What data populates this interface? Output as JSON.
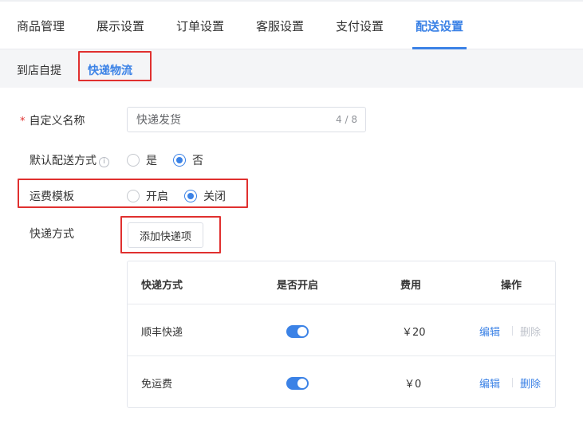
{
  "top_tabs": [
    {
      "label": "商品管理"
    },
    {
      "label": "展示设置"
    },
    {
      "label": "订单设置"
    },
    {
      "label": "客服设置"
    },
    {
      "label": "支付设置"
    },
    {
      "label": "配送设置"
    }
  ],
  "top_tabs_active_index": 5,
  "sub_tabs": [
    {
      "label": "到店自提"
    },
    {
      "label": "快递物流"
    }
  ],
  "sub_tabs_active_index": 1,
  "form": {
    "custom_name": {
      "required_mark": "*",
      "label": "自定义名称",
      "value": "快递发货",
      "counter": "4 / 8"
    },
    "default_delivery": {
      "label": "默认配送方式",
      "info_glyph": "i",
      "options": [
        "是",
        "否"
      ],
      "selected_index": 1
    },
    "freight_template": {
      "label": "运费模板",
      "options": [
        "开启",
        "关闭"
      ],
      "selected_index": 1
    },
    "express_methods": {
      "label": "快递方式",
      "add_button": "添加快递项"
    }
  },
  "table": {
    "headers": [
      "快递方式",
      "是否开启",
      "费用",
      "操作"
    ],
    "rows": [
      {
        "name": "顺丰快递",
        "enabled": true,
        "fee": "￥20",
        "edit": "编辑",
        "delete": "删除",
        "delete_disabled": true
      },
      {
        "name": "免运费",
        "enabled": true,
        "fee": "￥0",
        "edit": "编辑",
        "delete": "删除",
        "delete_disabled": false
      }
    ]
  },
  "colors": {
    "accent": "#3b82e6",
    "highlight_box": "#e0302f",
    "required": "#e0302f"
  }
}
